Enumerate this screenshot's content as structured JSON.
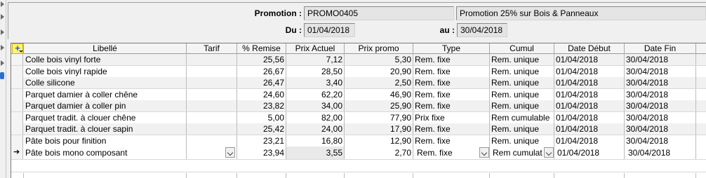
{
  "header": {
    "promotion_label": "Promotion :",
    "promotion_code": "PROMO0405",
    "promotion_desc": "Promotion 25% sur Bois & Panneaux",
    "du_label": "Du :",
    "du_value": "01/04/2018",
    "au_label": "au :",
    "au_value": "30/04/2018"
  },
  "grid": {
    "add_icon": "add-row-icon",
    "columns": [
      "Libellé",
      "Tarif",
      "% Remise",
      "Prix Actuel",
      "Prix promo",
      "Type",
      "Cumul",
      "Date Début",
      "Date Fin"
    ],
    "rows": [
      {
        "libelle": "Colle bois vinyl forte",
        "tarif": "",
        "remise": "25,56",
        "actuel": "7,12",
        "promo": "5,30",
        "type": "Rem. fixe",
        "cumul": "Rem. unique",
        "debut": "01/04/2018",
        "fin": "30/04/2018"
      },
      {
        "libelle": "Colle bois vinyl rapide",
        "tarif": "",
        "remise": "26,67",
        "actuel": "28,50",
        "promo": "20,90",
        "type": "Rem. fixe",
        "cumul": "Rem. unique",
        "debut": "01/04/2018",
        "fin": "30/04/2018"
      },
      {
        "libelle": "Colle silicone",
        "tarif": "",
        "remise": "26,47",
        "actuel": "3,40",
        "promo": "2,50",
        "type": "Rem. fixe",
        "cumul": "Rem. unique",
        "debut": "01/04/2018",
        "fin": "30/04/2018"
      },
      {
        "libelle": "Parquet damier à coller chêne",
        "tarif": "",
        "remise": "24,60",
        "actuel": "62,20",
        "promo": "46,90",
        "type": "Rem. fixe",
        "cumul": "Rem. unique",
        "debut": "01/04/2018",
        "fin": "30/04/2018"
      },
      {
        "libelle": "Parquet damier à coller pin",
        "tarif": "",
        "remise": "23,82",
        "actuel": "34,00",
        "promo": "25,90",
        "type": "Rem. fixe",
        "cumul": "Rem. unique",
        "debut": "01/04/2018",
        "fin": "30/04/2018"
      },
      {
        "libelle": "Parquet tradit. à clouer chêne",
        "tarif": "",
        "remise": "5,00",
        "actuel": "82,00",
        "promo": "77,90",
        "type": "Prix fixe",
        "cumul": "Rem cumulable",
        "debut": "01/04/2018",
        "fin": "30/04/2018"
      },
      {
        "libelle": "Parquet tradit. à clouer sapin",
        "tarif": "",
        "remise": "25,42",
        "actuel": "24,00",
        "promo": "17,90",
        "type": "Rem. fixe",
        "cumul": "Rem. unique",
        "debut": "01/04/2018",
        "fin": "30/04/2018"
      },
      {
        "libelle": "Pâte bois pour finition",
        "tarif": "",
        "remise": "23,21",
        "actuel": "16,80",
        "promo": "12,90",
        "type": "Rem. fixe",
        "cumul": "Rem. unique",
        "debut": "01/04/2018",
        "fin": "30/04/2018"
      }
    ],
    "current_row": {
      "libelle": "Pâte bois mono composant",
      "tarif": "",
      "remise": "23,94",
      "actuel": "3,55",
      "promo": "2,70",
      "type": "Rem. fixe",
      "cumul": "Rem cumulat",
      "debut": "01/04/2018",
      "fin": "30/04/2018"
    },
    "current_row_icon": "row-pointer-arrow-icon"
  }
}
